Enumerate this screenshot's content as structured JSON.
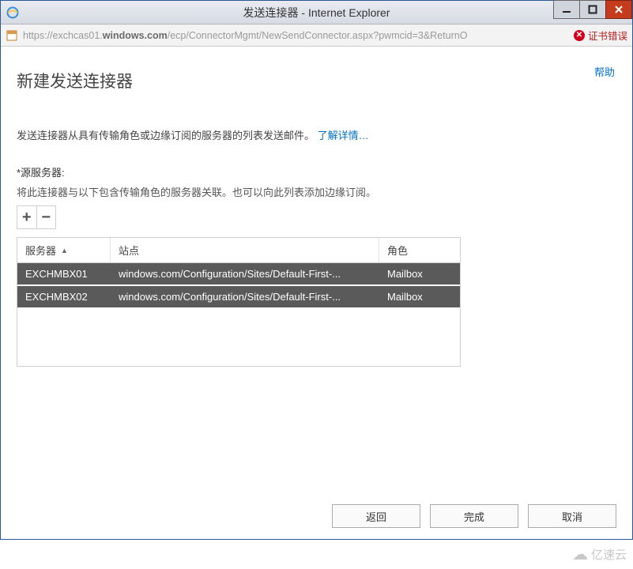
{
  "window": {
    "title": "发送连接器 - Internet Explorer"
  },
  "addressbar": {
    "url_prefix": "https://exchcas01.",
    "url_host": "windows.com",
    "url_path": "/ecp/ConnectorMgmt/NewSendConnector.aspx?pwmcid=3&ReturnO",
    "cert_error": "证书错误"
  },
  "page": {
    "help": "帮助",
    "title": "新建发送连接器",
    "desc_text": "发送连接器从具有传输角色或边缘订阅的服务器的列表发送邮件。",
    "learn_more": "了解详情…",
    "source_label": "*源服务器:",
    "source_hint": "将此连接器与以下包含传输角色的服务器关联。也可以向此列表添加边缘订阅。"
  },
  "grid": {
    "columns": {
      "server": "服务器",
      "site": "站点",
      "role": "角色"
    },
    "rows": [
      {
        "server": "EXCHMBX01",
        "site": "windows.com/Configuration/Sites/Default-First-...",
        "role": "Mailbox"
      },
      {
        "server": "EXCHMBX02",
        "site": "windows.com/Configuration/Sites/Default-First-...",
        "role": "Mailbox"
      }
    ]
  },
  "footer": {
    "back": "返回",
    "finish": "完成",
    "cancel": "取消"
  },
  "watermark": "亿速云"
}
